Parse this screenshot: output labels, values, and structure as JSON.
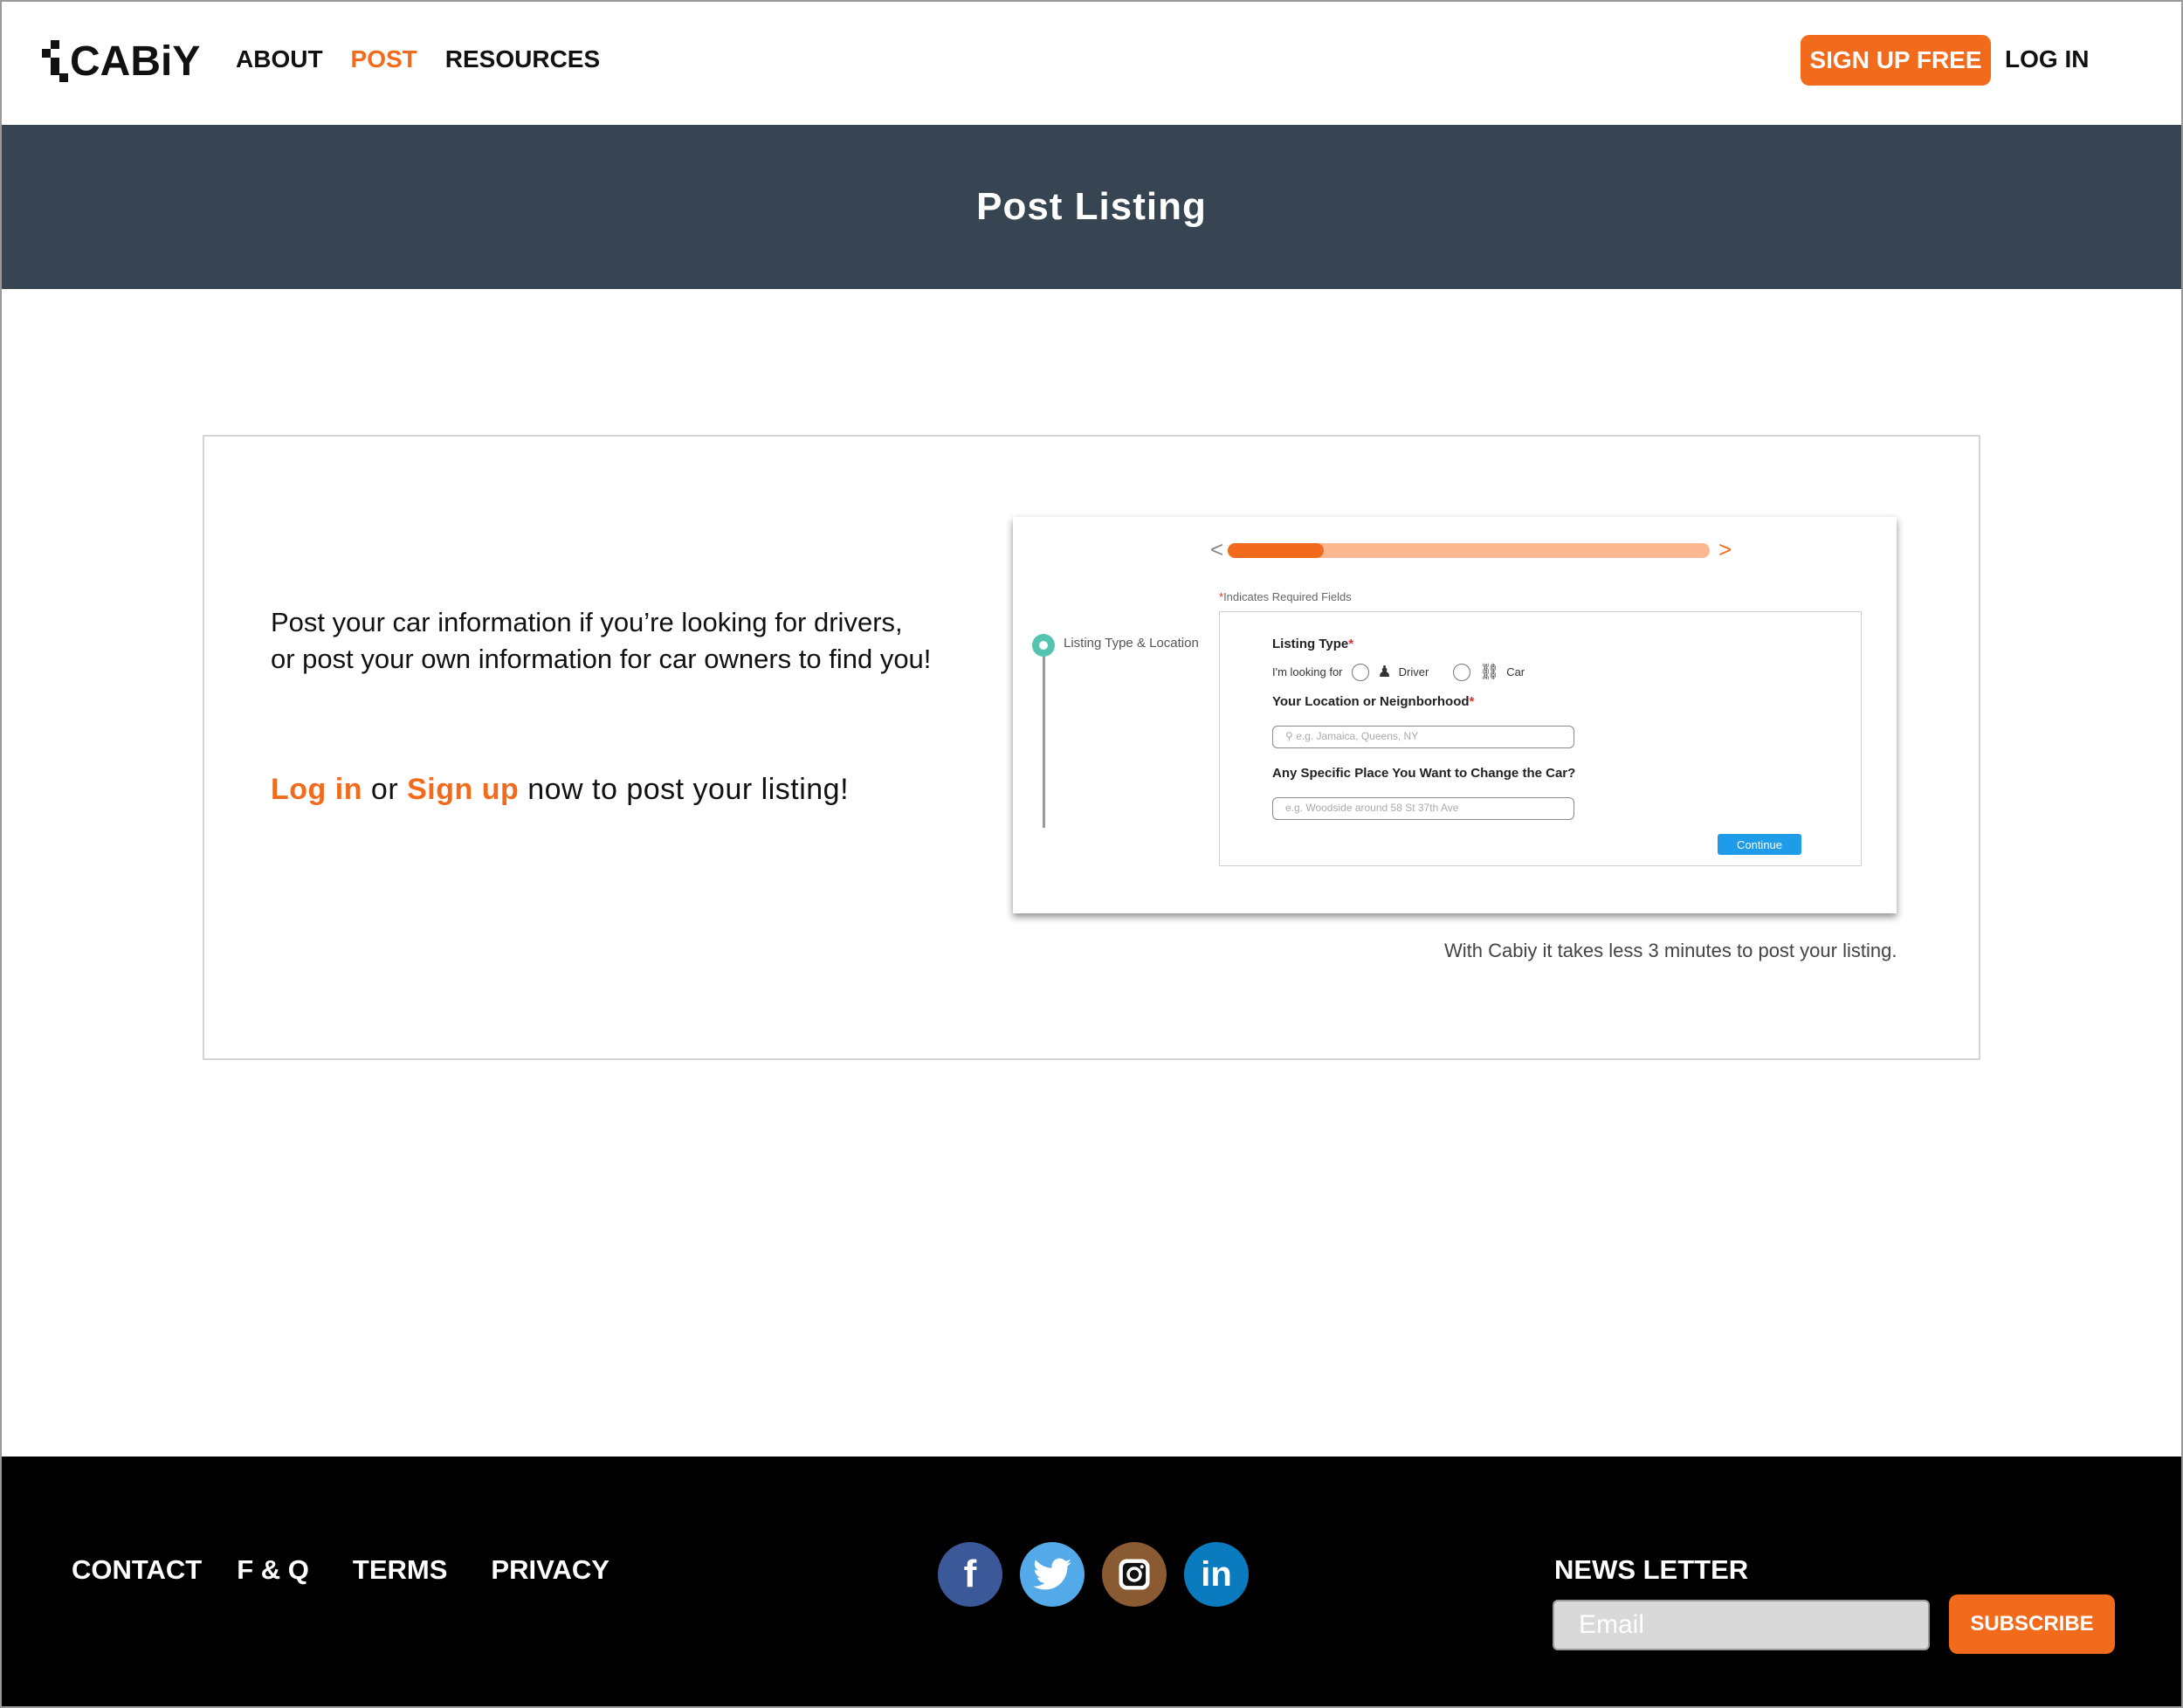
{
  "header": {
    "logo_text": "CABiY",
    "nav": [
      {
        "label": "ABOUT",
        "active": false
      },
      {
        "label": "POST",
        "active": true
      },
      {
        "label": "RESOURCES",
        "active": false
      }
    ],
    "signup_label": "SIGN UP FREE",
    "login_label": "LOG IN"
  },
  "banner": {
    "title": "Post Listing"
  },
  "main": {
    "intro_line1": "Post your car information if you’re looking for drivers,",
    "intro_line2": "or post your own information for car owners to find you!",
    "cta_login": "Log in",
    "cta_or": "or",
    "cta_signup": "Sign up",
    "cta_rest": "now to post your listing!",
    "caption": "With Cabiy it takes less 3 minutes to post your listing."
  },
  "preview": {
    "progress": 0.2,
    "required_note": "Indicates Required Fields",
    "required_star": "*",
    "step_label": "Listing Type & Location",
    "listing_type_label": "Listing Type",
    "looking_for_label": "I'm looking for",
    "option_driver": "Driver",
    "option_car": "Car",
    "location_label": "Your Location or Neignborhood",
    "location_placeholder": "e.g. Jamaica, Queens, NY",
    "change_place_label": "Any Specific Place You Want to Change the Car?",
    "change_place_placeholder": "e.g. Woodside around 58 St 37th Ave",
    "continue_label": "Continue"
  },
  "footer": {
    "links": [
      "CONTACT",
      "F & Q",
      "TERMS",
      "PRIVACY"
    ],
    "social": [
      "facebook-icon",
      "twitter-icon",
      "instagram-icon",
      "linkedin-icon"
    ],
    "newsletter_title": "NEWS LETTER",
    "email_placeholder": "Email",
    "subscribe_label": "SUBSCRIBE"
  },
  "colors": {
    "accent": "#f26a1b",
    "banner": "#374451",
    "footer": "#000000",
    "continue": "#1e9be9"
  }
}
